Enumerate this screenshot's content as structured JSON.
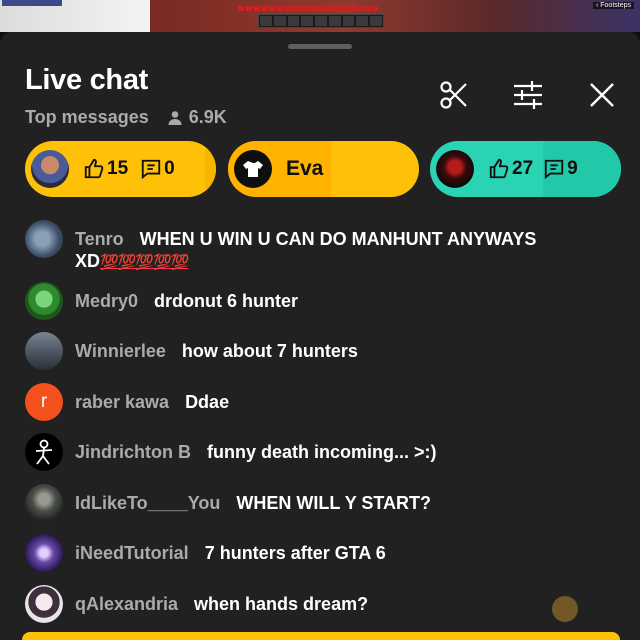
{
  "video": {
    "overlay_label": "‹ Footsteps"
  },
  "header": {
    "title": "Live chat",
    "mode": "Top messages",
    "viewers": "6.9K",
    "icons": [
      "scissors-icon",
      "tune-icon",
      "close-icon"
    ]
  },
  "highlights": [
    {
      "kind": "poll",
      "likes": "15",
      "comments": "0",
      "color": "#ffc107"
    },
    {
      "kind": "user",
      "name": "Eva",
      "color": "#ffc107"
    },
    {
      "kind": "poll",
      "likes": "27",
      "comments": "9",
      "color": "#29d3b3"
    }
  ],
  "messages": [
    {
      "author": "Tenro",
      "text": "WHEN U WIN U CAN DO MANHUNT ANYWAYS XD",
      "emoji": "💯💯💯💯💯",
      "avatar_color": "#3d4f66"
    },
    {
      "author": "Medry0",
      "text": "drdonut 6 hunter",
      "avatar_color": "#2f8a2f"
    },
    {
      "author": "Winnierlee",
      "text": "how about 7 hunters",
      "avatar_color": "#5a6470"
    },
    {
      "author": "raber kawa",
      "text": "Ddae",
      "avatar_letter": "r",
      "avatar_color": "#f4511e"
    },
    {
      "author": "Jindrichton B",
      "text": "funny death incoming... >:)",
      "avatar_color": "#000000"
    },
    {
      "author": "IdLikeTo____You",
      "text": "WHEN WILL Y START?",
      "avatar_color": "#4a4f48"
    },
    {
      "author": "iNeedTutorial",
      "text": "7 hunters after GTA 6",
      "avatar_color": "#6a4aa8"
    },
    {
      "author": "qAlexandria",
      "text": "when hands dream?",
      "avatar_color": "#e9e3ea"
    }
  ]
}
